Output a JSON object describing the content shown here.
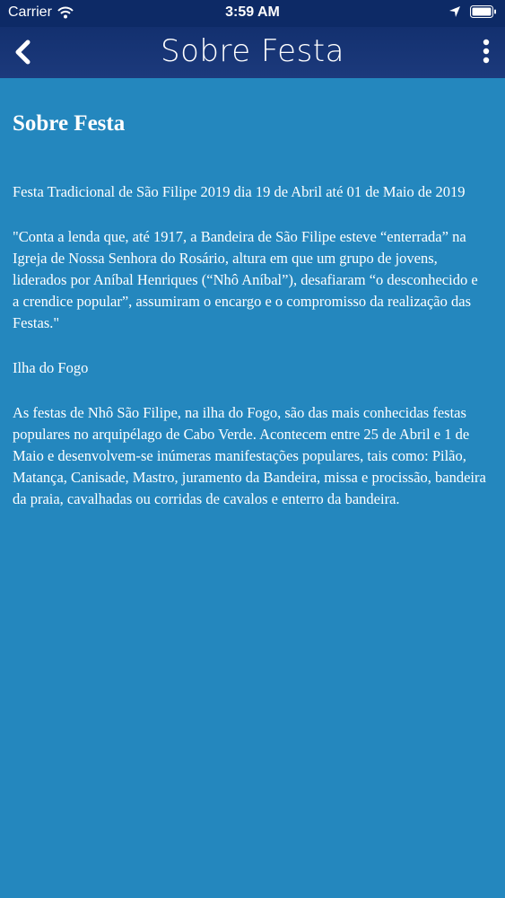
{
  "status_bar": {
    "carrier": "Carrier",
    "time": "3:59 AM"
  },
  "nav": {
    "title": "Sobre Festa",
    "back_icon": "chevron-left-icon",
    "more_icon": "more-vertical-icon"
  },
  "content": {
    "title": "Sobre Festa",
    "paragraphs": [
      "Festa Tradicional de São Filipe 2019 dia 19 de Abril até 01 de Maio de 2019",
      " \"Conta a lenda que, até 1917, a Bandeira de São Filipe esteve “enterrada” na Igreja de Nossa Senhora do Rosário, altura em que um grupo de jovens, liderados por Aníbal Henriques (“Nhô Aníbal”), desafiaram “o desconhecido e a crendice popular”, assumiram o encargo e o compromisso da realização das Festas.\"",
      "Ilha do Fogo",
      "As festas de Nhô São Filipe, na ilha do Fogo, são das mais conhecidas festas populares no arquipélago de Cabo Verde. Acontecem entre 25 de Abril e 1 de Maio e desenvolvem-se inúmeras manifestações populares, tais como: Pilão, Matança, Canisade, Mastro, juramento da Bandeira, missa e procissão, bandeira da praia, cavalhadas ou corridas de cavalos e enterro da bandeira."
    ]
  },
  "colors": {
    "background": "#2487be",
    "nav_background": "#13306f",
    "status_background": "#0d2a66",
    "text": "#ffffff"
  }
}
